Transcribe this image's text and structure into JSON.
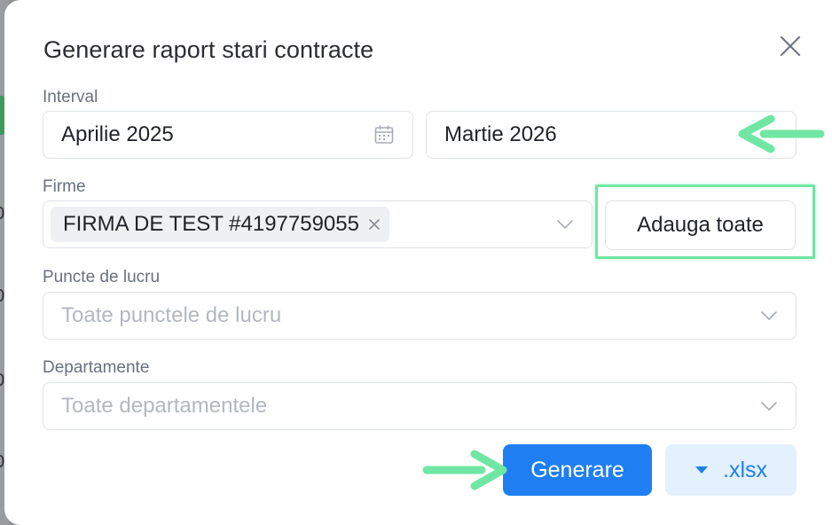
{
  "background_fragments": [
    "0",
    "0",
    "0",
    "0"
  ],
  "modal": {
    "title": "Generare raport stari contracte"
  },
  "interval": {
    "label": "Interval",
    "start_value": "Aprilie 2025",
    "end_value": "Martie 2026"
  },
  "firme": {
    "label": "Firme",
    "chip_label": "FIRMA DE TEST #4197759055",
    "add_all_label": "Adauga toate"
  },
  "puncte_de_lucru": {
    "label": "Puncte de lucru",
    "placeholder": "Toate punctele de lucru"
  },
  "departamente": {
    "label": "Departamente",
    "placeholder": "Toate departamentele"
  },
  "actions": {
    "generate_label": "Generare",
    "export_label": ".xlsx"
  },
  "colors": {
    "primary": "#1f7ff2",
    "annotation_green": "#6fe7a2"
  }
}
